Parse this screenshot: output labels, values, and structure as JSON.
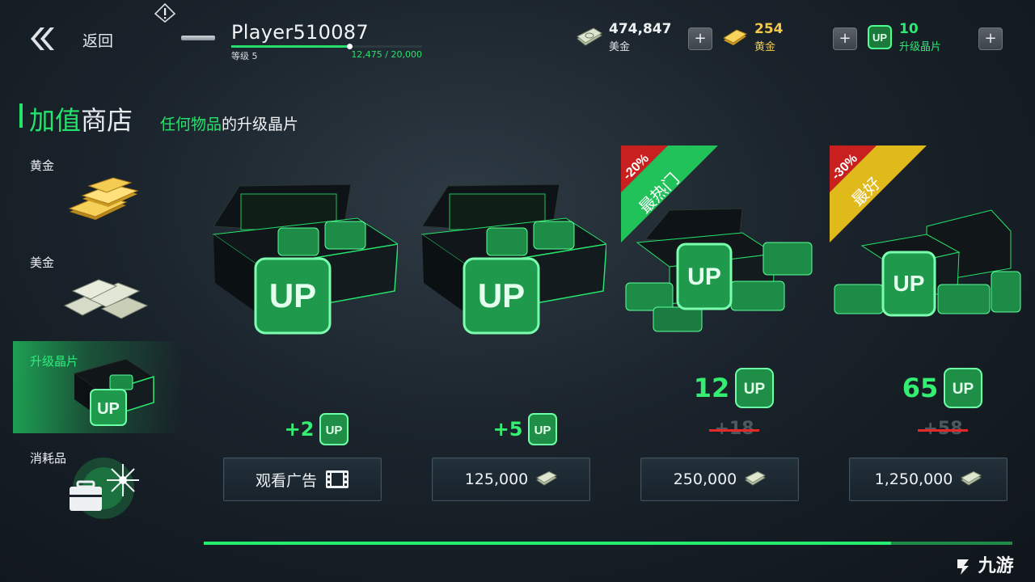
{
  "header": {
    "back_label": "返回",
    "player_name": "Player510087",
    "level_label": "等级 5",
    "xp_text": "12,475 / 20,000",
    "xp_fraction": 0.62
  },
  "currencies": {
    "cash": {
      "value": "474,847",
      "label": "美金"
    },
    "gold": {
      "value": "254",
      "label": "黄金",
      "color": "#f2c94c"
    },
    "upgrade_chips": {
      "value": "10",
      "label": "升级晶片",
      "color": "#2bea73"
    }
  },
  "title": {
    "part1": "加值",
    "part2": "商店",
    "subtitle_green": "任何物品",
    "subtitle_rest": "的升级晶片"
  },
  "sidebar": {
    "items": [
      {
        "label": "黄金"
      },
      {
        "label": "美金"
      },
      {
        "label": "升级晶片"
      },
      {
        "label": "消耗品"
      }
    ]
  },
  "offers": [
    {
      "amount": "+2",
      "button": "观看广告"
    },
    {
      "amount": "+5",
      "button": "125,000"
    },
    {
      "amount": "12",
      "old": "+18",
      "badge_discount": "-20%",
      "badge_label": "最热门",
      "button": "250,000"
    },
    {
      "amount": "65",
      "old": "+58",
      "badge_discount": "-30%",
      "badge_label": "最好",
      "button": "1,250,000"
    }
  ],
  "chip_icon_text": "UP",
  "watermark": "九游",
  "scroll_fraction": 0.85
}
